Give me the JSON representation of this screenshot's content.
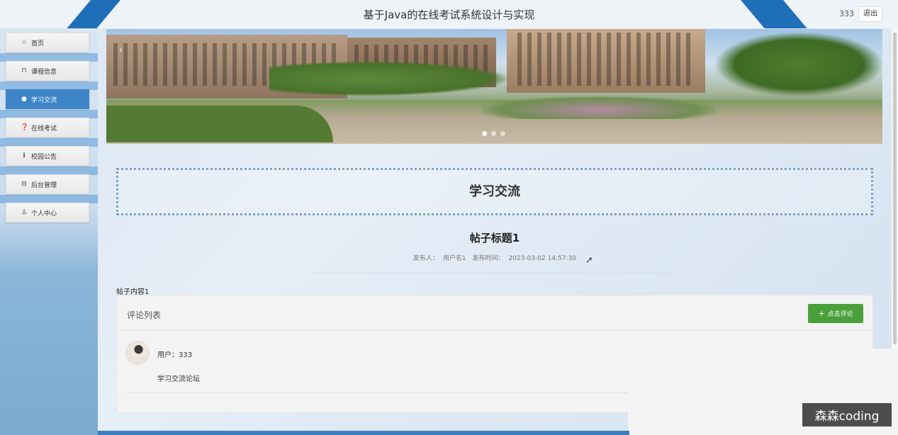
{
  "header": {
    "title": "基于Java的在线考试系统设计与实现",
    "username": "333",
    "logout_label": "退出"
  },
  "sidebar": {
    "items": [
      {
        "label": "首页",
        "icon": "star-icon",
        "active": false
      },
      {
        "label": "课程信息",
        "icon": "lock-icon",
        "active": false
      },
      {
        "label": "学习交流",
        "icon": "circle-icon",
        "active": true
      },
      {
        "label": "在线考试",
        "icon": "question-icon",
        "active": false
      },
      {
        "label": "校园公告",
        "icon": "info-icon",
        "active": false
      },
      {
        "label": "后台管理",
        "icon": "briefcase-icon",
        "active": false
      },
      {
        "label": "个人中心",
        "icon": "user-icon",
        "active": false
      }
    ]
  },
  "banner": {
    "prev_glyph": "‹",
    "slide_count": 3,
    "active_slide": 1
  },
  "section": {
    "title": "学习交流"
  },
  "post": {
    "title": "帖子标题1",
    "author_label": "发布人：",
    "author": "用户名1",
    "time_label": "发布时间：",
    "time": "2023-03-02 14:57:30",
    "content": "帖子内容1"
  },
  "comments": {
    "header_label": "评论列表",
    "add_button_label": "点击评论",
    "items": [
      {
        "user_label": "用户：",
        "user": "333",
        "text": "学习交流论坛"
      }
    ]
  },
  "watermark": "森森coding",
  "colors": {
    "accent": "#3d85c6",
    "header_wedge": "#1f6fb8",
    "comment_button": "#4aa13b"
  }
}
